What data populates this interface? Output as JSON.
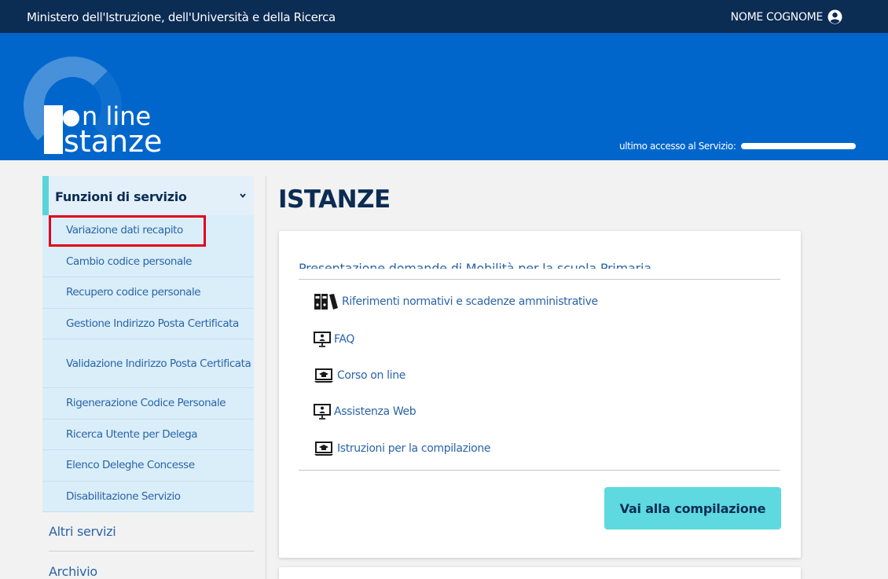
{
  "topbar": {
    "ministry": "Ministero dell'Istruzione, dell'Università e della Ricerca",
    "user_name": "NOME COGNOME",
    "user_icon": "user-circle-icon"
  },
  "header": {
    "logo_line1": "n line",
    "logo_line2": "stanze",
    "last_access_label": "ultimo accesso al Servizio:"
  },
  "sidebar": {
    "section_title": "Funzioni di servizio",
    "items": [
      {
        "label": "Variazione dati recapito",
        "highlighted": true
      },
      {
        "label": "Cambio codice personale"
      },
      {
        "label": "Recupero codice personale"
      },
      {
        "label": "Gestione Indirizzo Posta Certificata"
      },
      {
        "label": "Validazione Indirizzo Posta Certificata"
      },
      {
        "label": "Rigenerazione Codice Personale"
      },
      {
        "label": "Ricerca Utente per Delega"
      },
      {
        "label": "Elenco Deleghe Concesse"
      },
      {
        "label": "Disabilitazione Servizio"
      }
    ],
    "other_links": [
      {
        "label": "Altri servizi"
      },
      {
        "label": "Archivio"
      }
    ]
  },
  "main": {
    "title": "ISTANZE",
    "card": {
      "title": "Presentazione domande di Mobilità per la scuola Primaria",
      "links": [
        {
          "label": "Riferimenti normativi e scadenze amministrative",
          "icon": "binders-icon"
        },
        {
          "label": "FAQ",
          "icon": "presenter-screen-icon"
        },
        {
          "label": "Corso on line",
          "icon": "graduation-laptop-icon"
        },
        {
          "label": "Assistenza Web",
          "icon": "presenter-screen-icon"
        },
        {
          "label": "Istruzioni per la compilazione",
          "icon": "graduation-laptop-icon"
        }
      ],
      "button_label": "Vai alla compilazione"
    }
  },
  "colors": {
    "topbar": "#0b2c53",
    "header": "#0066cc",
    "accent": "#5dd9df",
    "link": "#2a64a8",
    "highlight_border": "#e2001a"
  }
}
